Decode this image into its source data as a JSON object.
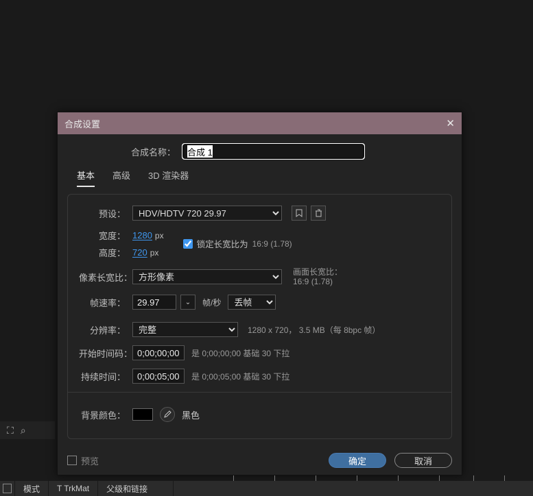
{
  "dialog": {
    "title": "合成设置",
    "close": "✕",
    "name_label": "合成名称：",
    "name_value": "合成 1",
    "tabs": {
      "basic": "基本",
      "advanced": "高级",
      "renderer": "3D 渲染器"
    },
    "preset": {
      "label": "预设：",
      "value": "HDV/HDTV 720 29.97",
      "save_icon": "↧",
      "delete_icon": "🗑"
    },
    "width": {
      "label": "宽度：",
      "value": "1280",
      "unit": "px"
    },
    "height": {
      "label": "高度：",
      "value": "720",
      "unit": "px"
    },
    "lock_aspect": {
      "label": "锁定长宽比为",
      "ratio": "16:9 (1.78)"
    },
    "pixel_aspect": {
      "label": "像素长宽比：",
      "value": "方形像素",
      "frame_ar_label": "画面长宽比：",
      "frame_ar_value": "16:9 (1.78)"
    },
    "framerate": {
      "label": "帧速率：",
      "value": "29.97",
      "unit": "帧/秒",
      "drop": "丢帧"
    },
    "resolution": {
      "label": "分辨率：",
      "value": "完整",
      "info": "1280 x 720， 3.5 MB（每 8bpc 帧）"
    },
    "start_tc": {
      "label": "开始时间码：",
      "value": "0;00;00;00",
      "info": "是 0;00;00;00  基础 30  下拉"
    },
    "duration": {
      "label": "持续时间：",
      "value": "0;00;05;00",
      "info": "是 0;00;05;00  基础 30  下拉"
    },
    "bgcolor": {
      "label": "背景颜色：",
      "name": "黑色"
    },
    "preview_label": "预览",
    "ok": "确定",
    "cancel": "取消"
  },
  "timeline": {
    "col_mode": "模式",
    "col_trkmat": "T  TrkMat",
    "col_parent": "父级和链接"
  }
}
